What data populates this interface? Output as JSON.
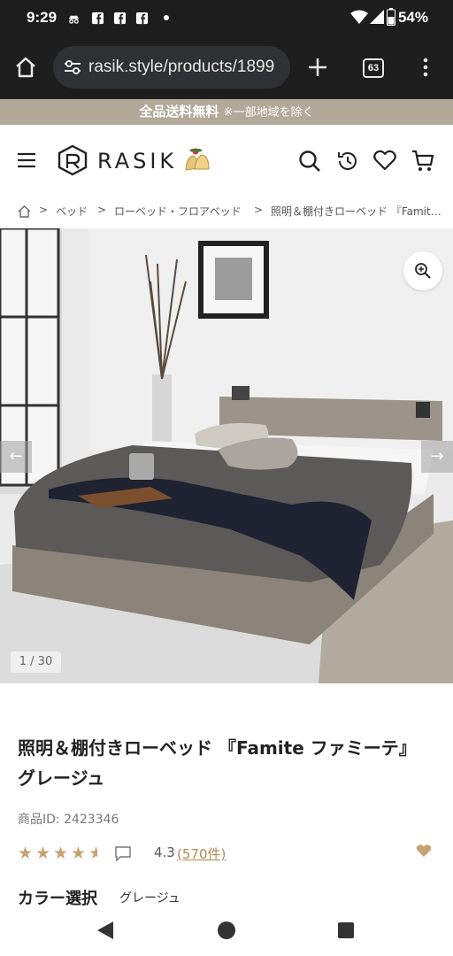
{
  "status_bar": {
    "time": "9:29",
    "battery": "54%",
    "icons": [
      "incognito-icon",
      "facebook-icon",
      "facebook-icon",
      "facebook-icon",
      "dot-icon",
      "wifi-icon",
      "signal-icon",
      "battery-icon"
    ]
  },
  "browser": {
    "url": "rasik.style/products/1899",
    "tab_count": "63",
    "icons": [
      "home-icon",
      "site-settings-icon",
      "new-tab-icon",
      "tab-switcher-icon",
      "more-menu-icon"
    ]
  },
  "promo": {
    "main": "全品送料無料",
    "sub": "※一部地域を除く"
  },
  "header": {
    "logo": "RASIK",
    "icons": [
      "hamburger-menu-icon",
      "search-icon",
      "history-icon",
      "heart-icon",
      "cart-icon"
    ]
  },
  "breadcrumb": {
    "items": [
      "ベッド",
      "ローベッド・フロアベッド",
      "照明＆棚付きローベッド 『Famit…"
    ]
  },
  "gallery": {
    "counter": "1 / 30"
  },
  "product": {
    "title": "照明＆棚付きローベッド 『Famite ファミーテ』グレージュ",
    "product_id": "商品ID: 2423346",
    "rating": "4.3",
    "rating_value": 4.3,
    "rating_max": 5,
    "review_count": "(570件)",
    "color_label": "カラー選択",
    "color_value": "グレージュ"
  },
  "colors": {
    "accent": "#c7a272",
    "promo_bg": "#b3a999",
    "dark": "#1d1d1d"
  }
}
